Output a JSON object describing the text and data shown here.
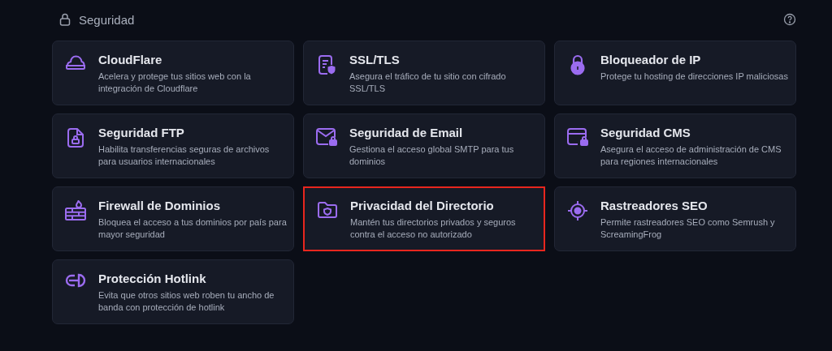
{
  "section": {
    "title": "Seguridad"
  },
  "cards": [
    {
      "title": "CloudFlare",
      "description": "Acelera y protege tus sitios web con la integración de Cloudflare",
      "highlighted": false
    },
    {
      "title": "SSL/TLS",
      "description": "Asegura el tráfico de tu sitio con cifrado SSL/TLS",
      "highlighted": false
    },
    {
      "title": "Bloqueador de IP",
      "description": "Protege tu hosting de direcciones IP maliciosas",
      "highlighted": false
    },
    {
      "title": "Seguridad FTP",
      "description": "Habilita transferencias seguras de archivos para usuarios internacionales",
      "highlighted": false
    },
    {
      "title": "Seguridad de Email",
      "description": "Gestiona el acceso global SMTP para tus dominios",
      "highlighted": false
    },
    {
      "title": "Seguridad CMS",
      "description": "Asegura el acceso de administración de CMS para regiones internacionales",
      "highlighted": false
    },
    {
      "title": "Firewall de Dominios",
      "description": "Bloquea el acceso a tus dominios por país para mayor seguridad",
      "highlighted": false
    },
    {
      "title": "Privacidad del Directorio",
      "description": "Mantén tus directorios privados y seguros contra el acceso no autorizado",
      "highlighted": true
    },
    {
      "title": "Rastreadores SEO",
      "description": "Permite rastreadores SEO como Semrush y ScreamingFrog",
      "highlighted": false
    },
    {
      "title": "Protección Hotlink",
      "description": "Evita que otros sitios web roben tu ancho de banda con protección de hotlink",
      "highlighted": false
    }
  ]
}
